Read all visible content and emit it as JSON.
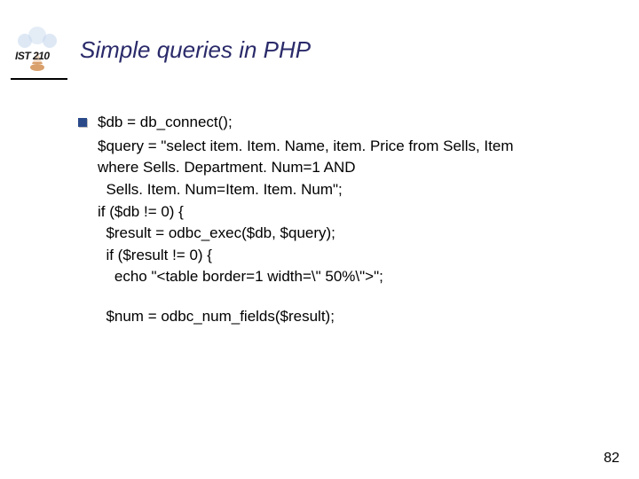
{
  "logo_label": "IST 210",
  "title": "Simple queries in PHP",
  "code": {
    "line1": "$db = db_connect();",
    "block": [
      "$query = \"select item. Item. Name, item. Price from Sells, Item",
      "where Sells. Department. Num=1 AND",
      "  Sells. Item. Num=Item. Item. Num\";",
      "if ($db != 0) {",
      "  $result = odbc_exec($db, $query);",
      "  if ($result != 0) {",
      "    echo \"<table border=1 width=\\\" 50%\\\">\";"
    ],
    "after_gap": "  $num = odbc_num_fields($result);"
  },
  "page_number": "82"
}
